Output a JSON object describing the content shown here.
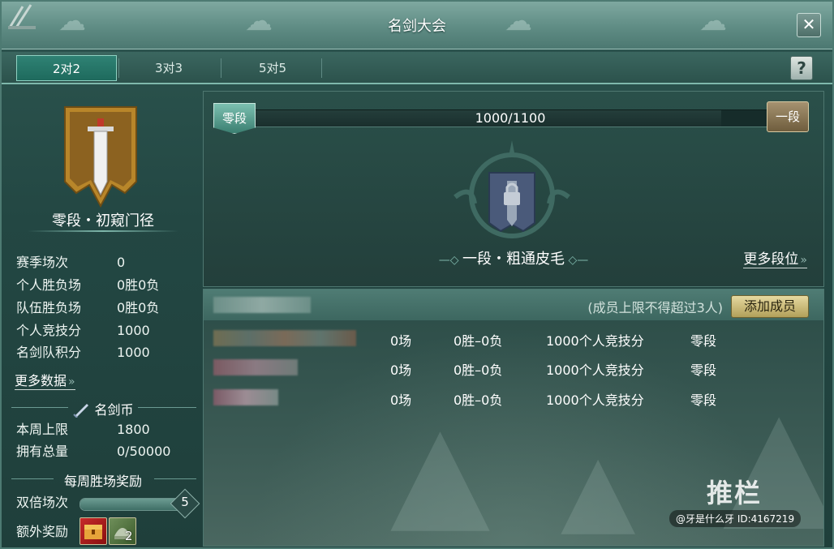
{
  "window": {
    "title": "名剑大会",
    "close": "✕"
  },
  "tabs": [
    {
      "label": "2对2",
      "active": true
    },
    {
      "label": "3对3",
      "active": false
    },
    {
      "label": "5对5",
      "active": false
    }
  ],
  "help": "?",
  "left": {
    "rank_title": "零段・初窥门径",
    "stats": [
      {
        "label": "赛季场次",
        "value": "0"
      },
      {
        "label": "个人胜负场",
        "value": "0胜0负"
      },
      {
        "label": "队伍胜负场",
        "value": "0胜0负"
      },
      {
        "label": "个人竞技分",
        "value": "1000"
      },
      {
        "label": "名剑队积分",
        "value": "1000"
      }
    ],
    "more_data": "更多数据",
    "coin_section": "名剑币",
    "coin_stats": [
      {
        "label": "本周上限",
        "value": "1800"
      },
      {
        "label": "拥有总量",
        "value": "0/50000"
      }
    ],
    "weekly_section": "每周胜场奖励",
    "double_label": "双倍场次",
    "double_value": "5",
    "double_fill": 1.0,
    "extra_label": "额外奖励",
    "extra_count": "2"
  },
  "progress": {
    "current_rank": "零段",
    "next_rank_badge": "一段",
    "text": "1000/1100",
    "fraction": 0.909
  },
  "next_rank": {
    "title": "一段・粗通皮毛",
    "more": "更多段位"
  },
  "members": {
    "limit_text": "(成员上限不得超过3人)",
    "add_button": "添加成员",
    "rows": [
      {
        "games": "0场",
        "record": "0胜–0负",
        "score": "1000个人竞技分",
        "rank": "零段"
      },
      {
        "games": "0场",
        "record": "0胜–0负",
        "score": "1000个人竞技分",
        "rank": "零段"
      },
      {
        "games": "0场",
        "record": "0胜–0负",
        "score": "1000个人竞技分",
        "rank": "零段"
      }
    ]
  },
  "watermark": {
    "brand": "推栏",
    "user": "@牙是什么牙  ID:4167219"
  },
  "colors": {
    "accent": "#2f8274",
    "button_gold": "#e6d9a0",
    "emblem_gold": "#b8862a"
  }
}
